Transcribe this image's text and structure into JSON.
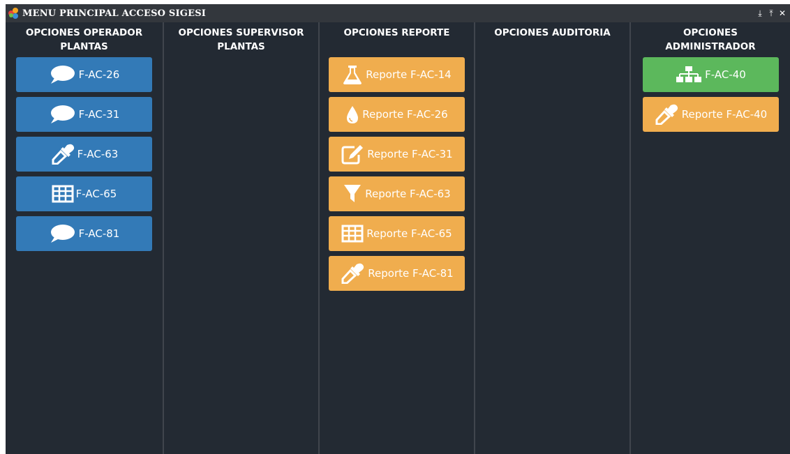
{
  "window": {
    "title": "MENU PRINCIPAL ACCESO SIGESI",
    "controls": [
      "⤓",
      "⤒",
      "✕"
    ]
  },
  "colors": {
    "operador_button": "#337ab7",
    "reporte_button": "#f0ad4e",
    "admin_green_button": "#5cb85c",
    "panel_background": "#232a33"
  },
  "columns": [
    {
      "header": "OPCIONES OPERADOR PLANTAS",
      "buttons": [
        {
          "label": "F-AC-26",
          "icon": "comment-icon"
        },
        {
          "label": "F-AC-31",
          "icon": "comment-icon"
        },
        {
          "label": "F-AC-63",
          "icon": "eyedropper-icon"
        },
        {
          "label": "F-AC-65",
          "icon": "table-icon"
        },
        {
          "label": "F-AC-81",
          "icon": "comment-icon"
        }
      ]
    },
    {
      "header": "OPCIONES SUPERVISOR PLANTAS",
      "buttons": []
    },
    {
      "header": "OPCIONES REPORTE",
      "buttons": [
        {
          "label": "Reporte F-AC-14",
          "icon": "flask-icon"
        },
        {
          "label": "Reporte F-AC-26",
          "icon": "droplet-icon"
        },
        {
          "label": "Reporte F-AC-31",
          "icon": "edit-icon"
        },
        {
          "label": "Reporte F-AC-63",
          "icon": "filter-icon"
        },
        {
          "label": "Reporte F-AC-65",
          "icon": "table-icon"
        },
        {
          "label": "Reporte F-AC-81",
          "icon": "eyedropper-icon"
        }
      ]
    },
    {
      "header": "OPCIONES AUDITORIA",
      "buttons": []
    },
    {
      "header": "OPCIONES ADMINISTRADOR",
      "buttons": [
        {
          "label": "F-AC-40",
          "icon": "sitemap-icon"
        },
        {
          "label": "Reporte F-AC-40",
          "icon": "eyedropper-icon"
        }
      ]
    }
  ]
}
